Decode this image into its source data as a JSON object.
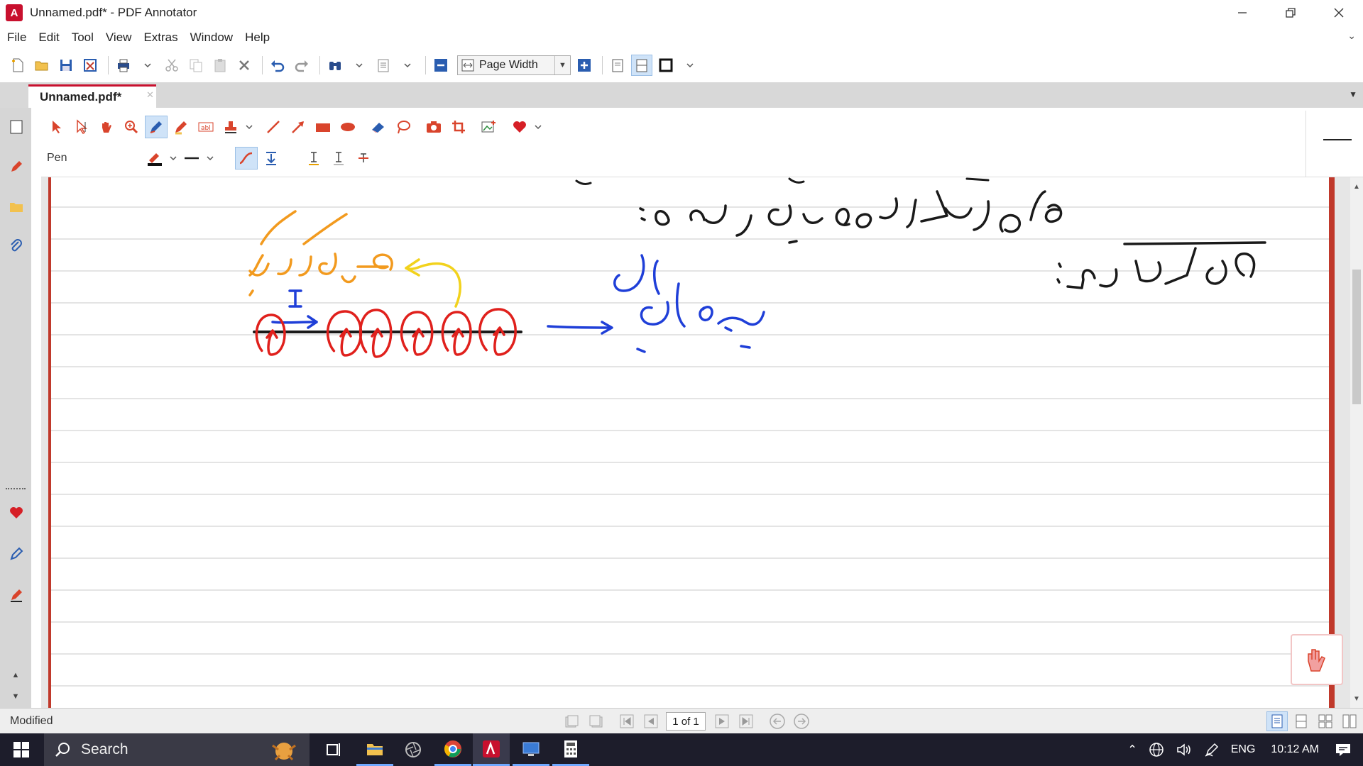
{
  "window": {
    "title": "Unnamed.pdf* - PDF Annotator",
    "controls": [
      "minimize",
      "restore",
      "close"
    ]
  },
  "menu": [
    "File",
    "Edit",
    "Tool",
    "View",
    "Extras",
    "Window",
    "Help"
  ],
  "toolbar": {
    "zoom_mode": "Page Width"
  },
  "tab": {
    "label": "Unnamed.pdf*"
  },
  "annotation_tools": {
    "current_tool_label": "Pen"
  },
  "document": {
    "handwriting_colors": {
      "black": "#1a1a1a",
      "orange": "#f29a1e",
      "yellow": "#f2d21c",
      "blue": "#1f3fd8",
      "red": "#e0201c"
    },
    "ruled_line_color": "#dcdcdc",
    "page_border_color": "#c0392b",
    "current_label": "I"
  },
  "status": {
    "text": "Modified",
    "page_indicator": "1 of 1"
  },
  "taskbar": {
    "search_placeholder": "Search",
    "language": "ENG",
    "time": "10:12 AM"
  }
}
